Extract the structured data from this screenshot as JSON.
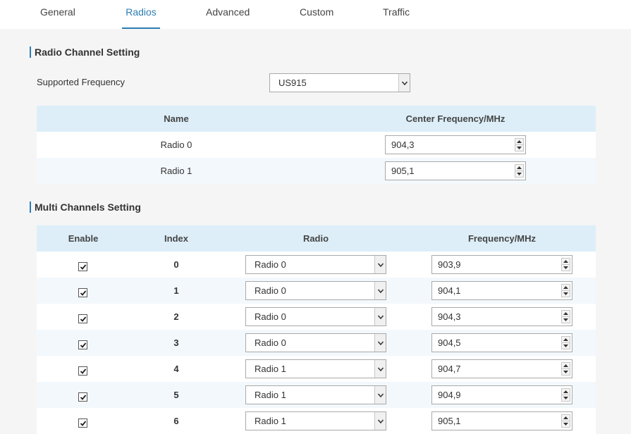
{
  "tabs": [
    {
      "label": "General"
    },
    {
      "label": "Radios"
    },
    {
      "label": "Advanced"
    },
    {
      "label": "Custom"
    },
    {
      "label": "Traffic"
    }
  ],
  "active_tab": "Radios",
  "accent_color": "#2d7db3",
  "radio_channel": {
    "title": "Radio Channel Setting",
    "supported_frequency_label": "Supported Frequency",
    "supported_frequency_value": "US915",
    "columns": [
      "Name",
      "Center Frequency/MHz"
    ],
    "rows": [
      {
        "name": "Radio 0",
        "freq": "904,3"
      },
      {
        "name": "Radio 1",
        "freq": "905,1"
      }
    ]
  },
  "multi_channel": {
    "title": "Multi Channels Setting",
    "columns": [
      "Enable",
      "Index",
      "Radio",
      "Frequency/MHz"
    ],
    "rows": [
      {
        "enabled": true,
        "index": "0",
        "radio": "Radio 0",
        "freq": "903,9"
      },
      {
        "enabled": true,
        "index": "1",
        "radio": "Radio 0",
        "freq": "904,1"
      },
      {
        "enabled": true,
        "index": "2",
        "radio": "Radio 0",
        "freq": "904,3"
      },
      {
        "enabled": true,
        "index": "3",
        "radio": "Radio 0",
        "freq": "904,5"
      },
      {
        "enabled": true,
        "index": "4",
        "radio": "Radio 1",
        "freq": "904,7"
      },
      {
        "enabled": true,
        "index": "5",
        "radio": "Radio 1",
        "freq": "904,9"
      },
      {
        "enabled": true,
        "index": "6",
        "radio": "Radio 1",
        "freq": "905,1"
      }
    ]
  }
}
